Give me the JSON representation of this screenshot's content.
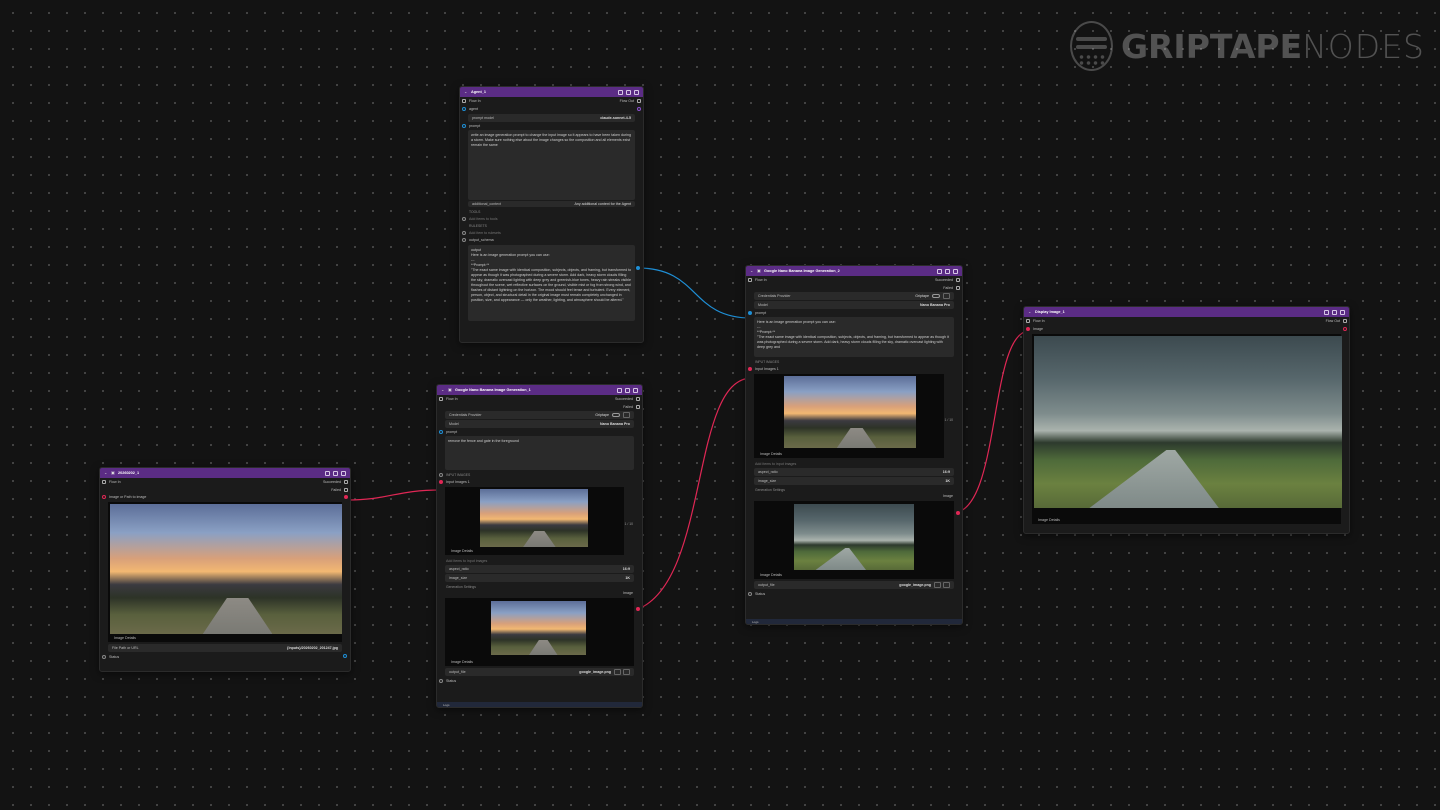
{
  "logo": {
    "word1": "GRIPTAPE",
    "word2": "NODES"
  },
  "agent": {
    "title": "Agent_1",
    "flow_in": "Flow In",
    "flow_out": "Flow Out",
    "agent": "agent",
    "prompt_model_label": "prompt model",
    "prompt_model_value": "claude-sonnet-4-5",
    "prompt_label": "prompt",
    "prompt_text": "write an image generation prompt to change the input image so it appears to have been taken during a storm. Make sure nothing else about the image changes so the composition and all elements exist remain the same",
    "additional_context_label": "additional_context",
    "additional_context_hint": "Any additional context for the Agent",
    "tools_label": "TOOLS",
    "tools_hint": "Add items to tools",
    "rulesets_label": "RULESETS",
    "rulesets_hint": "Add item to rulesets",
    "output_schema_label": "output_schema",
    "output_label": "output",
    "output_line1": "Here is an image generation prompt you can use:",
    "output_line2": "---",
    "output_line3": "**Prompt:**",
    "output_text": "\"The exact same image with identical composition, subjects, objects, and framing, but transformed to appear as though it was photographed during a severe storm. Add dark, heavy storm clouds filling the sky, dramatic overcast lighting with deep grey and greenish-blue tones, heavy rain streaks visible throughout the scene, wet reflective surfaces on the ground, visible mist or fog from strong wind, and flashes of distant lightning on the horizon. The mood should feel tense and turbulent. Every element, person, object, and structural detail in the original image must remain completely unchanged in position, size, and appearance — only the weather, lighting, and atmosphere should be altered.\""
  },
  "source": {
    "title": "20260202_1",
    "flow_in": "Flow In",
    "succeeded": "Succeeded",
    "failed": "Failed",
    "image_label": "Image or Path to image",
    "image_details": "Image Details",
    "file_path_label": "File Path or URL",
    "file_path_value": "{inputs}/20260202_201247.jpg",
    "status": "Status"
  },
  "gen1": {
    "title": "Google Nano Banana Image Generation_1",
    "flow_in": "Flow In",
    "succeeded": "Succeeded",
    "failed": "Failed",
    "credentials_label": "Credentials Provider",
    "credentials_value": "Griptape",
    "model_label": "Model",
    "model_value": "Nano Banana Pro",
    "prompt_label": "prompt",
    "prompt_text": "remove the fence and gate in the foreground",
    "input_images_label": "INPUT IMAGES",
    "input_images_item": "Input Images 1",
    "image_details": "Image Details",
    "add_hint": "Add items to input images",
    "count": "1 / 10",
    "aspect_ratio_label": "aspect_ratio",
    "aspect_ratio_value": "16:9",
    "image_size_label": "image_size",
    "image_size_value": "1K",
    "generation_settings": "Generation Settings",
    "image_out": "Image",
    "image_details2": "Image Details",
    "output_file_label": "output_file",
    "output_file_value": "google_image.png",
    "status": "Status",
    "logs": "Logs"
  },
  "gen2": {
    "title": "Google Nano Banana Image Generation_2",
    "flow_in": "Flow In",
    "succeeded": "Succeeded",
    "failed": "Failed",
    "credentials_label": "Credentials Provider",
    "credentials_value": "Griptape",
    "model_label": "Model",
    "model_value": "Nano Banana Pro",
    "prompt_label": "prompt",
    "prompt_line1": "Here is an image generation prompt you can use:",
    "prompt_line2": "---",
    "prompt_line3": "**Prompt:**",
    "prompt_text": "\"The exact same image with identical composition, subjects, objects, and framing, but transformed to appear as though it was photographed during a severe storm. Add dark, heavy storm clouds filling the sky, dramatic overcast lighting with deep grey and",
    "input_images_label": "INPUT IMAGES",
    "input_images_item": "Input Images 1",
    "image_details": "Image Details",
    "add_hint": "Add items to input images",
    "count": "1 / 10",
    "aspect_ratio_label": "aspect_ratio",
    "aspect_ratio_value": "16:9",
    "image_size_label": "image_size",
    "image_size_value": "1K",
    "generation_settings": "Generation Settings",
    "image_out": "Image",
    "image_details2": "Image Details",
    "output_file_label": "output_file",
    "output_file_value": "google_image.png",
    "status": "Status",
    "logs": "Logs"
  },
  "display": {
    "title": "Display Image_1",
    "flow_in": "Flow In",
    "flow_out": "Flow Out",
    "image_label": "Image",
    "image_details": "Image Details"
  },
  "colors": {
    "header": "#5b2c85",
    "wire_blue": "#1f8fd6",
    "wire_red": "#e02755"
  }
}
